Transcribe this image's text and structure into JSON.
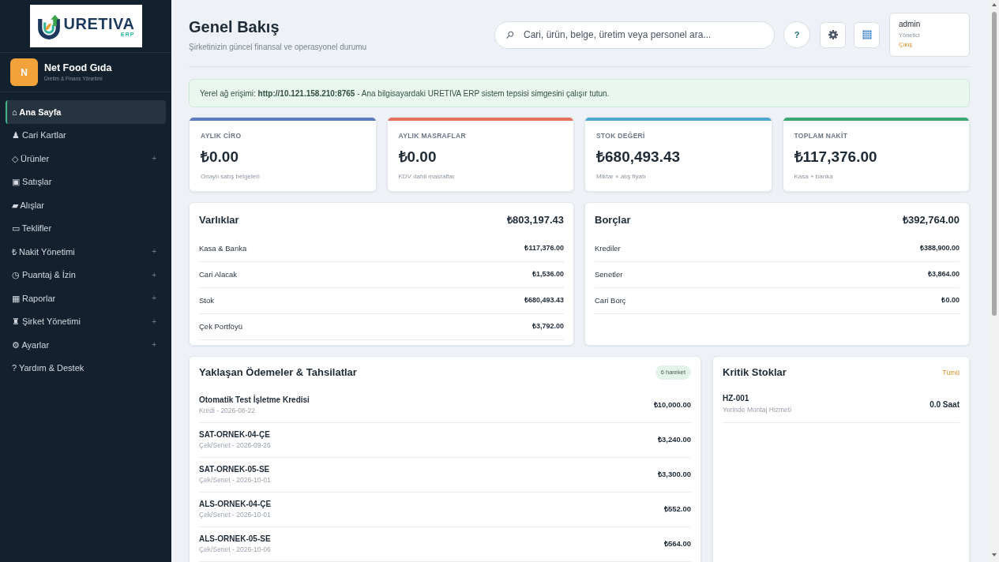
{
  "sidebar": {
    "logo": {
      "name": "URETIVA",
      "suffix": "ERP"
    },
    "company": {
      "initial": "N",
      "name": "Net Food Gıda",
      "subtitle": "Üretim & Finans Yönetimi"
    },
    "items": [
      {
        "label": "⌂ Ana Sayfa",
        "selected": true
      },
      {
        "label": "♟ Cari Kartlar",
        "selected": false
      },
      {
        "label": "◇ Ürünler",
        "selected": false,
        "toggle": "+"
      },
      {
        "label": "▣ Satışlar",
        "selected": false
      },
      {
        "label": "▰ Alışlar",
        "selected": false
      },
      {
        "label": "▭ Teklifler",
        "selected": false
      },
      {
        "label": "₺ Nakit Yönetimi",
        "selected": false,
        "toggle": "+"
      },
      {
        "label": "◷ Puantaj & İzin",
        "selected": false,
        "toggle": "+"
      },
      {
        "label": "▦ Raporlar",
        "selected": false,
        "toggle": "+"
      },
      {
        "label": "♜ Şirket Yönetimi",
        "selected": false,
        "toggle": "+"
      },
      {
        "label": "⚙ Ayarlar",
        "selected": false,
        "toggle": "+"
      },
      {
        "label": "? Yardım & Destek",
        "selected": false
      }
    ]
  },
  "header": {
    "title": "Genel Bakış",
    "subtitle": "Şirketinizin güncel finansal ve operasyonel durumu",
    "search": {
      "placeholder": "Cari, ürün, belge, üretim veya personel ara..."
    },
    "help_button": "?",
    "user": {
      "name": "admin",
      "role": "Yönetici",
      "logout": "Çıkış"
    }
  },
  "notice": "Yerel ağ erişimi: **http://10.121.158.210:8765** - Ana bilgisayardaki URETIVA ERP sistem tepsisi simgesini çalışır tutun.",
  "kpis": [
    {
      "label": "AYLIK CİRO",
      "value": "₺0.00",
      "note": "Onaylı satış belgeleri",
      "color": "#5b7cbf"
    },
    {
      "label": "AYLIK MASRAFLAR",
      "value": "₺0.00",
      "note": "KDV dahil masraflar",
      "color": "#e5725f"
    },
    {
      "label": "STOK DEĞERİ",
      "value": "₺680,493.43",
      "note": "Miktar × alış fiyatı",
      "color": "#4ea7d2"
    },
    {
      "label": "TOPLAM NAKİT",
      "value": "₺117,376.00",
      "note": "Kasa + banka",
      "color": "#3aa672"
    }
  ],
  "balances": [
    {
      "title": "Varlıklar",
      "total": "₺803,197.43",
      "rows": [
        {
          "label": "Kasa & Banka",
          "amount": "₺117,376.00"
        },
        {
          "label": "Cari Alacak",
          "amount": "₺1,536.00"
        },
        {
          "label": "Stok",
          "amount": "₺680,493.43"
        },
        {
          "label": "Çek Portföyü",
          "amount": "₺3,792.00"
        }
      ]
    },
    {
      "title": "Borçlar",
      "total": "₺392,764.00",
      "rows": [
        {
          "label": "Krediler",
          "amount": "₺388,900.00"
        },
        {
          "label": "Senetler",
          "amount": "₺3,864.00"
        },
        {
          "label": "Cari Borç",
          "amount": "₺0.00"
        }
      ]
    }
  ],
  "upcoming": {
    "title": "Yaklaşan Ödemeler & Tahsilatlar",
    "badge": "6 hareket",
    "rows": [
      {
        "title": "Otomatik Test İşletme Kredisi",
        "subtitle": "Kredi - 2026-08-22",
        "amount": "₺10,000.00"
      },
      {
        "title": "SAT-ORNEK-04-ÇE",
        "subtitle": "Çek/Senet - 2026-09-26",
        "amount": "₺3,240.00"
      },
      {
        "title": "SAT-ORNEK-05-SE",
        "subtitle": "Çek/Senet - 2026-10-01",
        "amount": "₺3,300.00"
      },
      {
        "title": "ALS-ORNEK-04-ÇE",
        "subtitle": "Çek/Senet - 2026-10-01",
        "amount": "₺552.00"
      },
      {
        "title": "ALS-ORNEK-05-SE",
        "subtitle": "Çek/Senet - 2026-10-06",
        "amount": "₺564.00"
      }
    ]
  },
  "critical_stock": {
    "title": "Kritik Stoklar",
    "link": "Tümü",
    "rows": [
      {
        "code": "HZ-001",
        "name": "Yerinde Montaj Hizmeti",
        "quantity": "0.0 Saat"
      }
    ]
  }
}
